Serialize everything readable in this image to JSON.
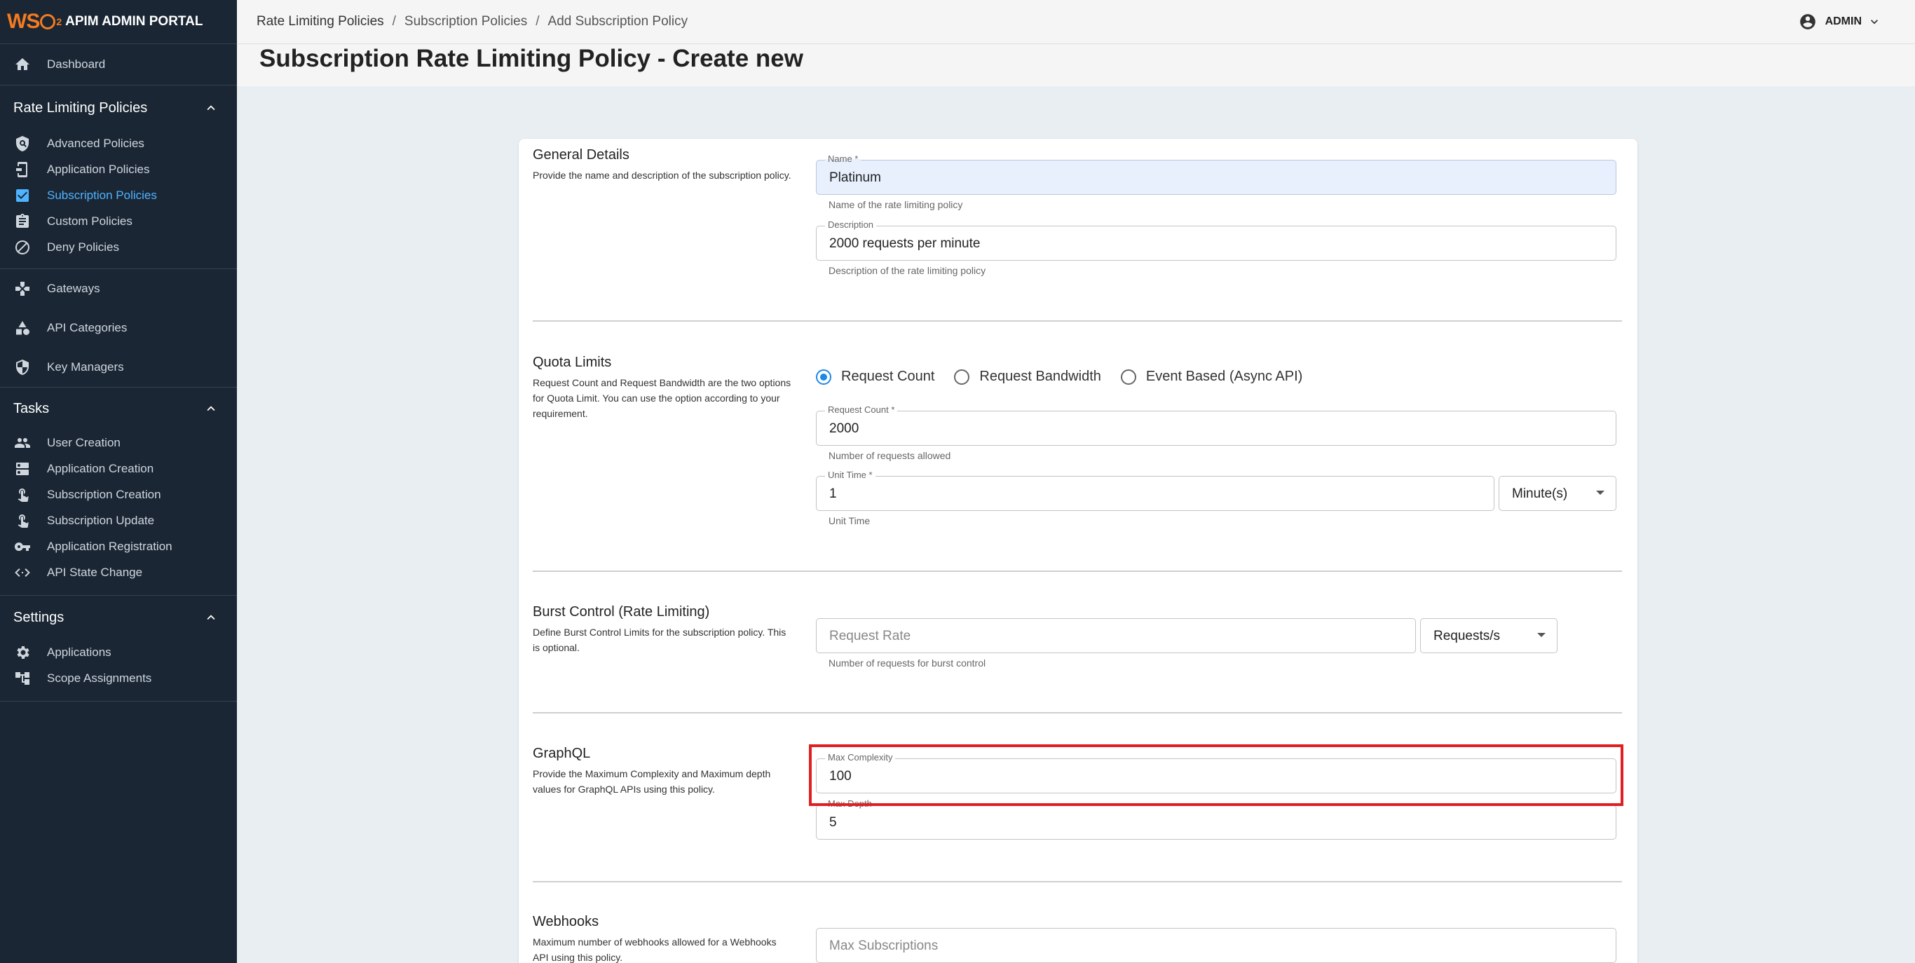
{
  "brand": {
    "logo_text": "WSO2",
    "title": "APIM ADMIN PORTAL"
  },
  "sidebar": {
    "dashboard": "Dashboard",
    "rate_group": "Rate Limiting Policies",
    "rate_items": [
      "Advanced Policies",
      "Application Policies",
      "Subscription Policies",
      "Custom Policies",
      "Deny Policies"
    ],
    "gateways": "Gateways",
    "api_categories": "API Categories",
    "key_managers": "Key Managers",
    "tasks_group": "Tasks",
    "task_items": [
      "User Creation",
      "Application Creation",
      "Subscription Creation",
      "Subscription Update",
      "Application Registration",
      "API State Change"
    ],
    "settings_group": "Settings",
    "settings_items": [
      "Applications",
      "Scope Assignments"
    ]
  },
  "header": {
    "breadcrumb": [
      "Rate Limiting Policies",
      "Subscription Policies",
      "Add Subscription Policy"
    ],
    "separator": "/",
    "user": "ADMIN"
  },
  "page_title": "Subscription Rate Limiting Policy - Create new",
  "general": {
    "title": "General Details",
    "desc": "Provide the name and description of the subscription policy.",
    "name_label": "Name *",
    "name_value": "Platinum",
    "name_helper": "Name of the rate limiting policy",
    "desc_label": "Description",
    "desc_value": "2000 requests per minute",
    "desc_helper": "Description of the rate limiting policy"
  },
  "quota": {
    "title": "Quota Limits",
    "desc": "Request Count and Request Bandwidth are the two options for Quota Limit. You can use the option according to your requirement.",
    "options": [
      "Request Count",
      "Request Bandwidth",
      "Event Based (Async API)"
    ],
    "selected": "Request Count",
    "count_label": "Request Count *",
    "count_value": "2000",
    "count_helper": "Number of requests allowed",
    "unit_label": "Unit Time *",
    "unit_value": "1",
    "unit_helper": "Unit Time",
    "unit_select": "Minute(s)"
  },
  "burst": {
    "title": "Burst Control (Rate Limiting)",
    "desc": "Define Burst Control Limits for the subscription policy. This is optional.",
    "rate_placeholder": "Request Rate",
    "rate_helper": "Number of requests for burst control",
    "unit_select": "Requests/s"
  },
  "graphql": {
    "title": "GraphQL",
    "desc": "Provide the Maximum Complexity and Maximum depth values for GraphQL APIs using this policy.",
    "complexity_label": "Max Complexity",
    "complexity_value": "100",
    "depth_label": "Max Depth",
    "depth_value": "5"
  },
  "webhooks": {
    "title": "Webhooks",
    "desc": "Maximum number of webhooks allowed for a Webhooks API using this policy.",
    "subs_placeholder": "Max Subscriptions"
  },
  "colors": {
    "sidebar_bg": "#1a2634",
    "accent": "#4fb3ff",
    "highlight": "#e02020",
    "radio": "#1e88e5"
  }
}
